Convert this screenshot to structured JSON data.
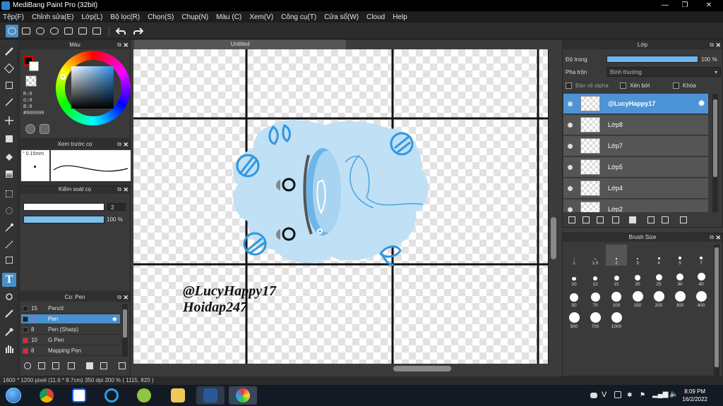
{
  "window": {
    "title": "MediBang Paint Pro (32bit)",
    "controls": [
      "—",
      "❐",
      "✕"
    ]
  },
  "menu": [
    "Tệp(F)",
    "Chỉnh sửa(E)",
    "Lớp(L)",
    "Bộ lọc(R)",
    "Chọn(S)",
    "Chụp(N)",
    "Màu (C)",
    "Xem(V)",
    "Công cụ(T)",
    "Cửa sổ(W)",
    "Cloud",
    "Help"
  ],
  "color_panel": {
    "title": "Màu",
    "r": "R:0",
    "g": "G:0",
    "b": "B:0",
    "hex": "#000000"
  },
  "preview_panel": {
    "title": "Xem trước cọ",
    "size": "0.15mm"
  },
  "brush_control": {
    "title": "Kiểm soát cọ",
    "size_value": "2",
    "opacity_value": "100 %",
    "opacity": 1.0
  },
  "brush_panel": {
    "title": "Cọ: Pen",
    "items": [
      {
        "size": "15",
        "name": "Pencil",
        "color": "dark"
      },
      {
        "size": "2",
        "name": "Pen",
        "color": "dark",
        "selected": true
      },
      {
        "size": "8",
        "name": "Pen (Sharp)",
        "color": "dark"
      },
      {
        "size": "10",
        "name": "G Pen",
        "color": "red"
      },
      {
        "size": "8",
        "name": "Mapping Pen",
        "color": "red"
      }
    ]
  },
  "canvas": {
    "tab": "Untitled",
    "text_line1": "@LucyHappy17",
    "text_line2": "Hoidap247",
    "accent": "#3a9ee0",
    "blob_color": "#bfe0f5"
  },
  "layer_panel": {
    "title": "Lớp",
    "opacity_label": "Độ trong",
    "opacity_value": "100 %",
    "opacity": 1.0,
    "blend_label": "Pha trộn",
    "blend_value": "Bình thường",
    "protect_alpha": "Bảo vệ alpha",
    "clip": "Xén bớt",
    "lock": "Khóa",
    "layers": [
      {
        "name": "@LucyHappy17",
        "selected": true
      },
      {
        "name": "Lớp8"
      },
      {
        "name": "Lớp7"
      },
      {
        "name": "Lớp5"
      },
      {
        "name": "Lớp4"
      },
      {
        "name": "Lớp2"
      }
    ]
  },
  "brush_size_panel": {
    "title": "Brush Size",
    "sizes": [
      "1",
      "1.5",
      "2",
      "3",
      "4",
      "5",
      "7",
      "10",
      "12",
      "15",
      "20",
      "25",
      "30",
      "40",
      "50",
      "70",
      "100",
      "150",
      "200",
      "300",
      "400",
      "500",
      "700",
      "1000"
    ]
  },
  "status": {
    "size": "1600 * 1200 pixel",
    "physical": "(11.6 * 8.7cm)",
    "dpi": "350 dpi",
    "zoom": "200 %",
    "cursor": "( 1115, 820 )"
  },
  "taskbar": {
    "apps": [
      "chrome-icon",
      "zalo-icon",
      "ie-icon",
      "green-app-icon",
      "folder-icon",
      "word-icon",
      "medibang-icon"
    ],
    "tray_letter": "V",
    "time": "8:09 PM",
    "date": "16/2/2022"
  }
}
